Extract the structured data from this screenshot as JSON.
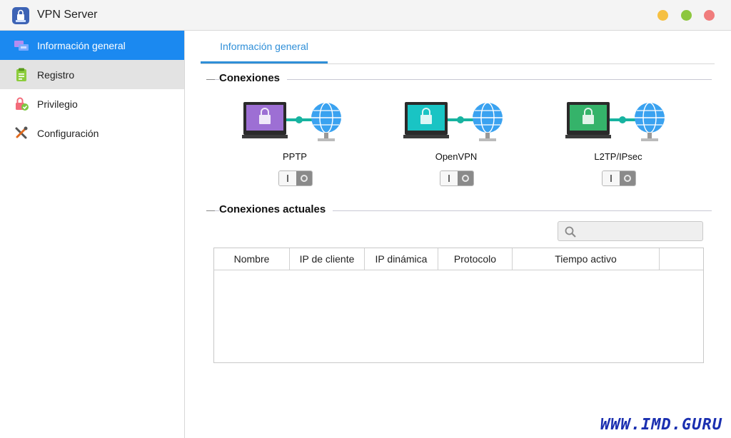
{
  "window": {
    "title": "VPN Server",
    "controls": {
      "minimize_color": "#f6c042",
      "maximize_color": "#8dc73f",
      "close_color": "#f07c7c"
    }
  },
  "sidebar": {
    "items": [
      {
        "label": "Información general",
        "icon": "overview-icon",
        "active": true
      },
      {
        "label": "Registro",
        "icon": "log-icon",
        "active": false
      },
      {
        "label": "Privilegio",
        "icon": "privilege-icon",
        "active": false
      },
      {
        "label": "Configuración",
        "icon": "settings-icon",
        "active": false
      }
    ]
  },
  "main": {
    "tab_label": "Información general",
    "connections_title": "Conexiones",
    "protocols": [
      {
        "name": "PPTP",
        "screen_color": "#9d6fd4",
        "enabled": false
      },
      {
        "name": "OpenVPN",
        "screen_color": "#19c4c4",
        "enabled": false
      },
      {
        "name": "L2TP/IPsec",
        "screen_color": "#35b36a",
        "enabled": false
      }
    ],
    "current_title": "Conexiones actuales",
    "search": {
      "value": "",
      "placeholder": ""
    },
    "table": {
      "columns": [
        "Nombre",
        "IP de cliente",
        "IP dinámica",
        "Protocolo",
        "Tiempo activo",
        ""
      ],
      "rows": []
    }
  },
  "watermark": "WWW.IMD.GURU",
  "colors": {
    "accent": "#1b89f0",
    "tab_accent": "#2f8fd8"
  }
}
